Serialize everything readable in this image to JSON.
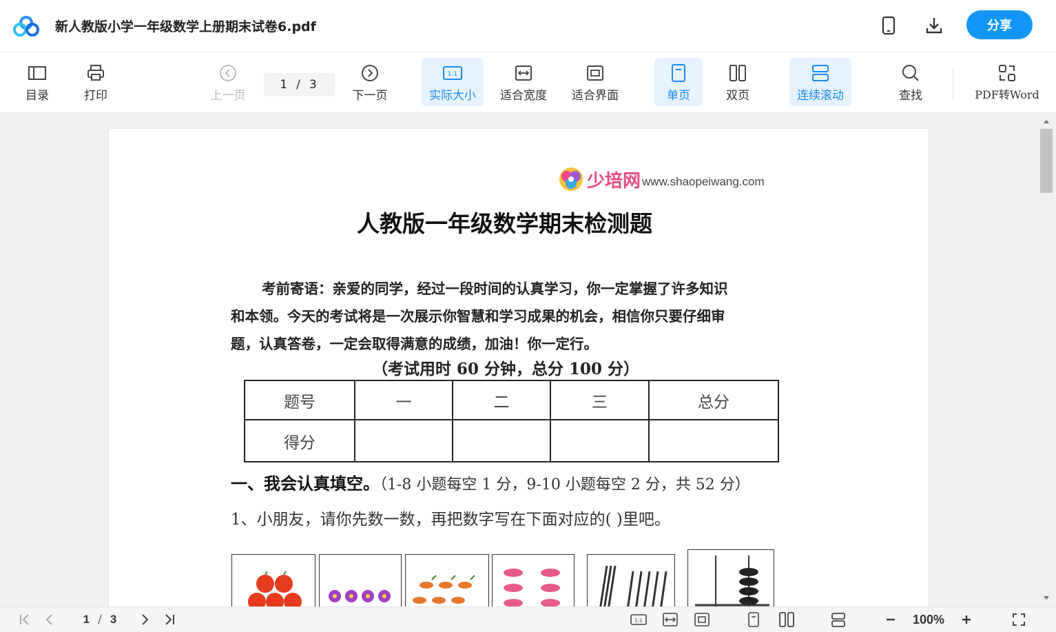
{
  "window": {
    "title": "新人教版小学一年级数学上册期末试卷6.pdf",
    "share_label": "分享"
  },
  "toolbar": {
    "toc": "目录",
    "print": "打印",
    "prev": "上一页",
    "current_page": "1",
    "page_sep": "/",
    "total_pages": "3",
    "next": "下一页",
    "actual_size": "实际大小",
    "fit_width": "适合宽度",
    "fit_page": "适合界面",
    "single_page": "单页",
    "double_page": "双页",
    "continuous": "连续滚动",
    "search": "查找",
    "pdf_to_word": "PDF转Word"
  },
  "document": {
    "brand_cn": "少培网",
    "brand_url": "www.shaopeiwang.com",
    "title": "人教版一年级数学期末检测题",
    "intro_lines": [
      "考前寄语：亲爱的同学，经过一段时间的认真学习，你一定掌握了许多知识",
      "和本领。今天的考试将是一次展示你智慧和学习成果的机会，相信你只要仔细审",
      "题，认真答卷，一定会取得满意的成绩，加油！你一定行。"
    ],
    "time_note": "（考试用时 60 分钟，总分 100 分）",
    "score_table": {
      "header": [
        "题号",
        "一",
        "二",
        "三",
        "总分"
      ],
      "row": [
        "得分",
        "",
        "",
        "",
        ""
      ]
    },
    "section1_title": "一、我会认真填空。",
    "section1_note": "（1-8 小题每空 1 分，9-10 小题每空 2 分，共 52 分）",
    "q1_text": "1、小朋友，请你先数一数，再把数字写在下面对应的(      )里吧。"
  },
  "bottombar": {
    "current_page": "1",
    "page_sep": "/",
    "total_pages": "3",
    "zoom": "100%"
  },
  "colors": {
    "accent": "#1296f6",
    "active_bg": "#e6f2fd",
    "active_text": "#1a8cf0"
  }
}
